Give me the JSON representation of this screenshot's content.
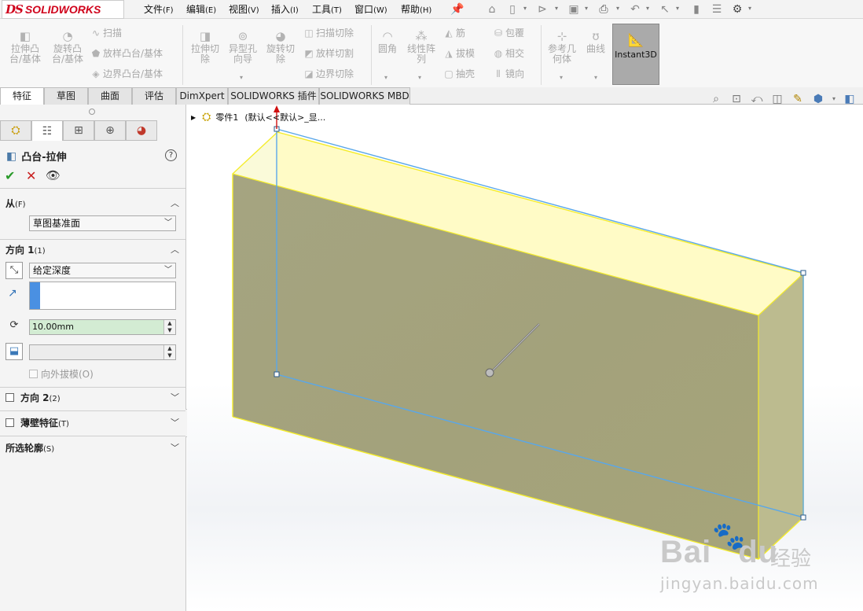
{
  "app": {
    "logo_prefix": "DS",
    "logo_text": "SOLIDWORKS"
  },
  "menu": [
    {
      "label": "文件",
      "key": "(F)"
    },
    {
      "label": "编辑",
      "key": "(E)"
    },
    {
      "label": "视图",
      "key": "(V)"
    },
    {
      "label": "插入",
      "key": "(I)"
    },
    {
      "label": "工具",
      "key": "(T)"
    },
    {
      "label": "窗口",
      "key": "(W)"
    },
    {
      "label": "帮助",
      "key": "(H)"
    }
  ],
  "ribbon": {
    "extrude_boss": "拉伸凸台/基体",
    "revolve_boss": "旋转凸台/基体",
    "sweep": "扫描",
    "loft_boss": "放样凸台/基体",
    "boundary_boss": "边界凸台/基体",
    "extrude_cut": "拉伸切除",
    "hole_wizard": "异型孔向导",
    "revolve_cut": "旋转切除",
    "sweep_cut": "扫描切除",
    "loft_cut": "放样切割",
    "boundary_cut": "边界切除",
    "fillet": "圆角",
    "linear_pattern": "线性阵列",
    "rib": "筋",
    "draft": "拔模",
    "shell": "抽壳",
    "wrap": "包覆",
    "intersect": "相交",
    "mirror": "镜向",
    "ref_geometry": "参考几何体",
    "curves": "曲线",
    "instant3d": "Instant3D"
  },
  "tabs": [
    "特征",
    "草图",
    "曲面",
    "评估",
    "DimXpert",
    "SOLIDWORKS 插件",
    "SOLIDWORKS MBD"
  ],
  "tree": {
    "part": "零件1",
    "config": "(默认<<默认>_显..."
  },
  "pm": {
    "title": "凸台-拉伸",
    "from": {
      "label": "从",
      "key": "(F)",
      "value": "草图基准面"
    },
    "direction1": {
      "label": "方向 1",
      "key": "(1)",
      "end_condition": "给定深度",
      "depth": "10.00mm",
      "angle": "",
      "draft_outward": "向外拔模(O)"
    },
    "direction2": {
      "label": "方向 2",
      "key": "(2)"
    },
    "thin": {
      "label": "薄壁特征",
      "key": "(T)"
    },
    "contours": {
      "label": "所选轮廓",
      "key": "(S)"
    }
  },
  "watermark": {
    "brand": "Bai",
    "brand2": "du",
    "cn": "经验",
    "url": "jingyan.baidu.com"
  },
  "colors": {
    "face_front": "#a3a27c",
    "face_top": "#fffbc4",
    "edge": "#f2ea2f",
    "sketch": "#5aa7e8",
    "accent_red": "#d0021b"
  }
}
